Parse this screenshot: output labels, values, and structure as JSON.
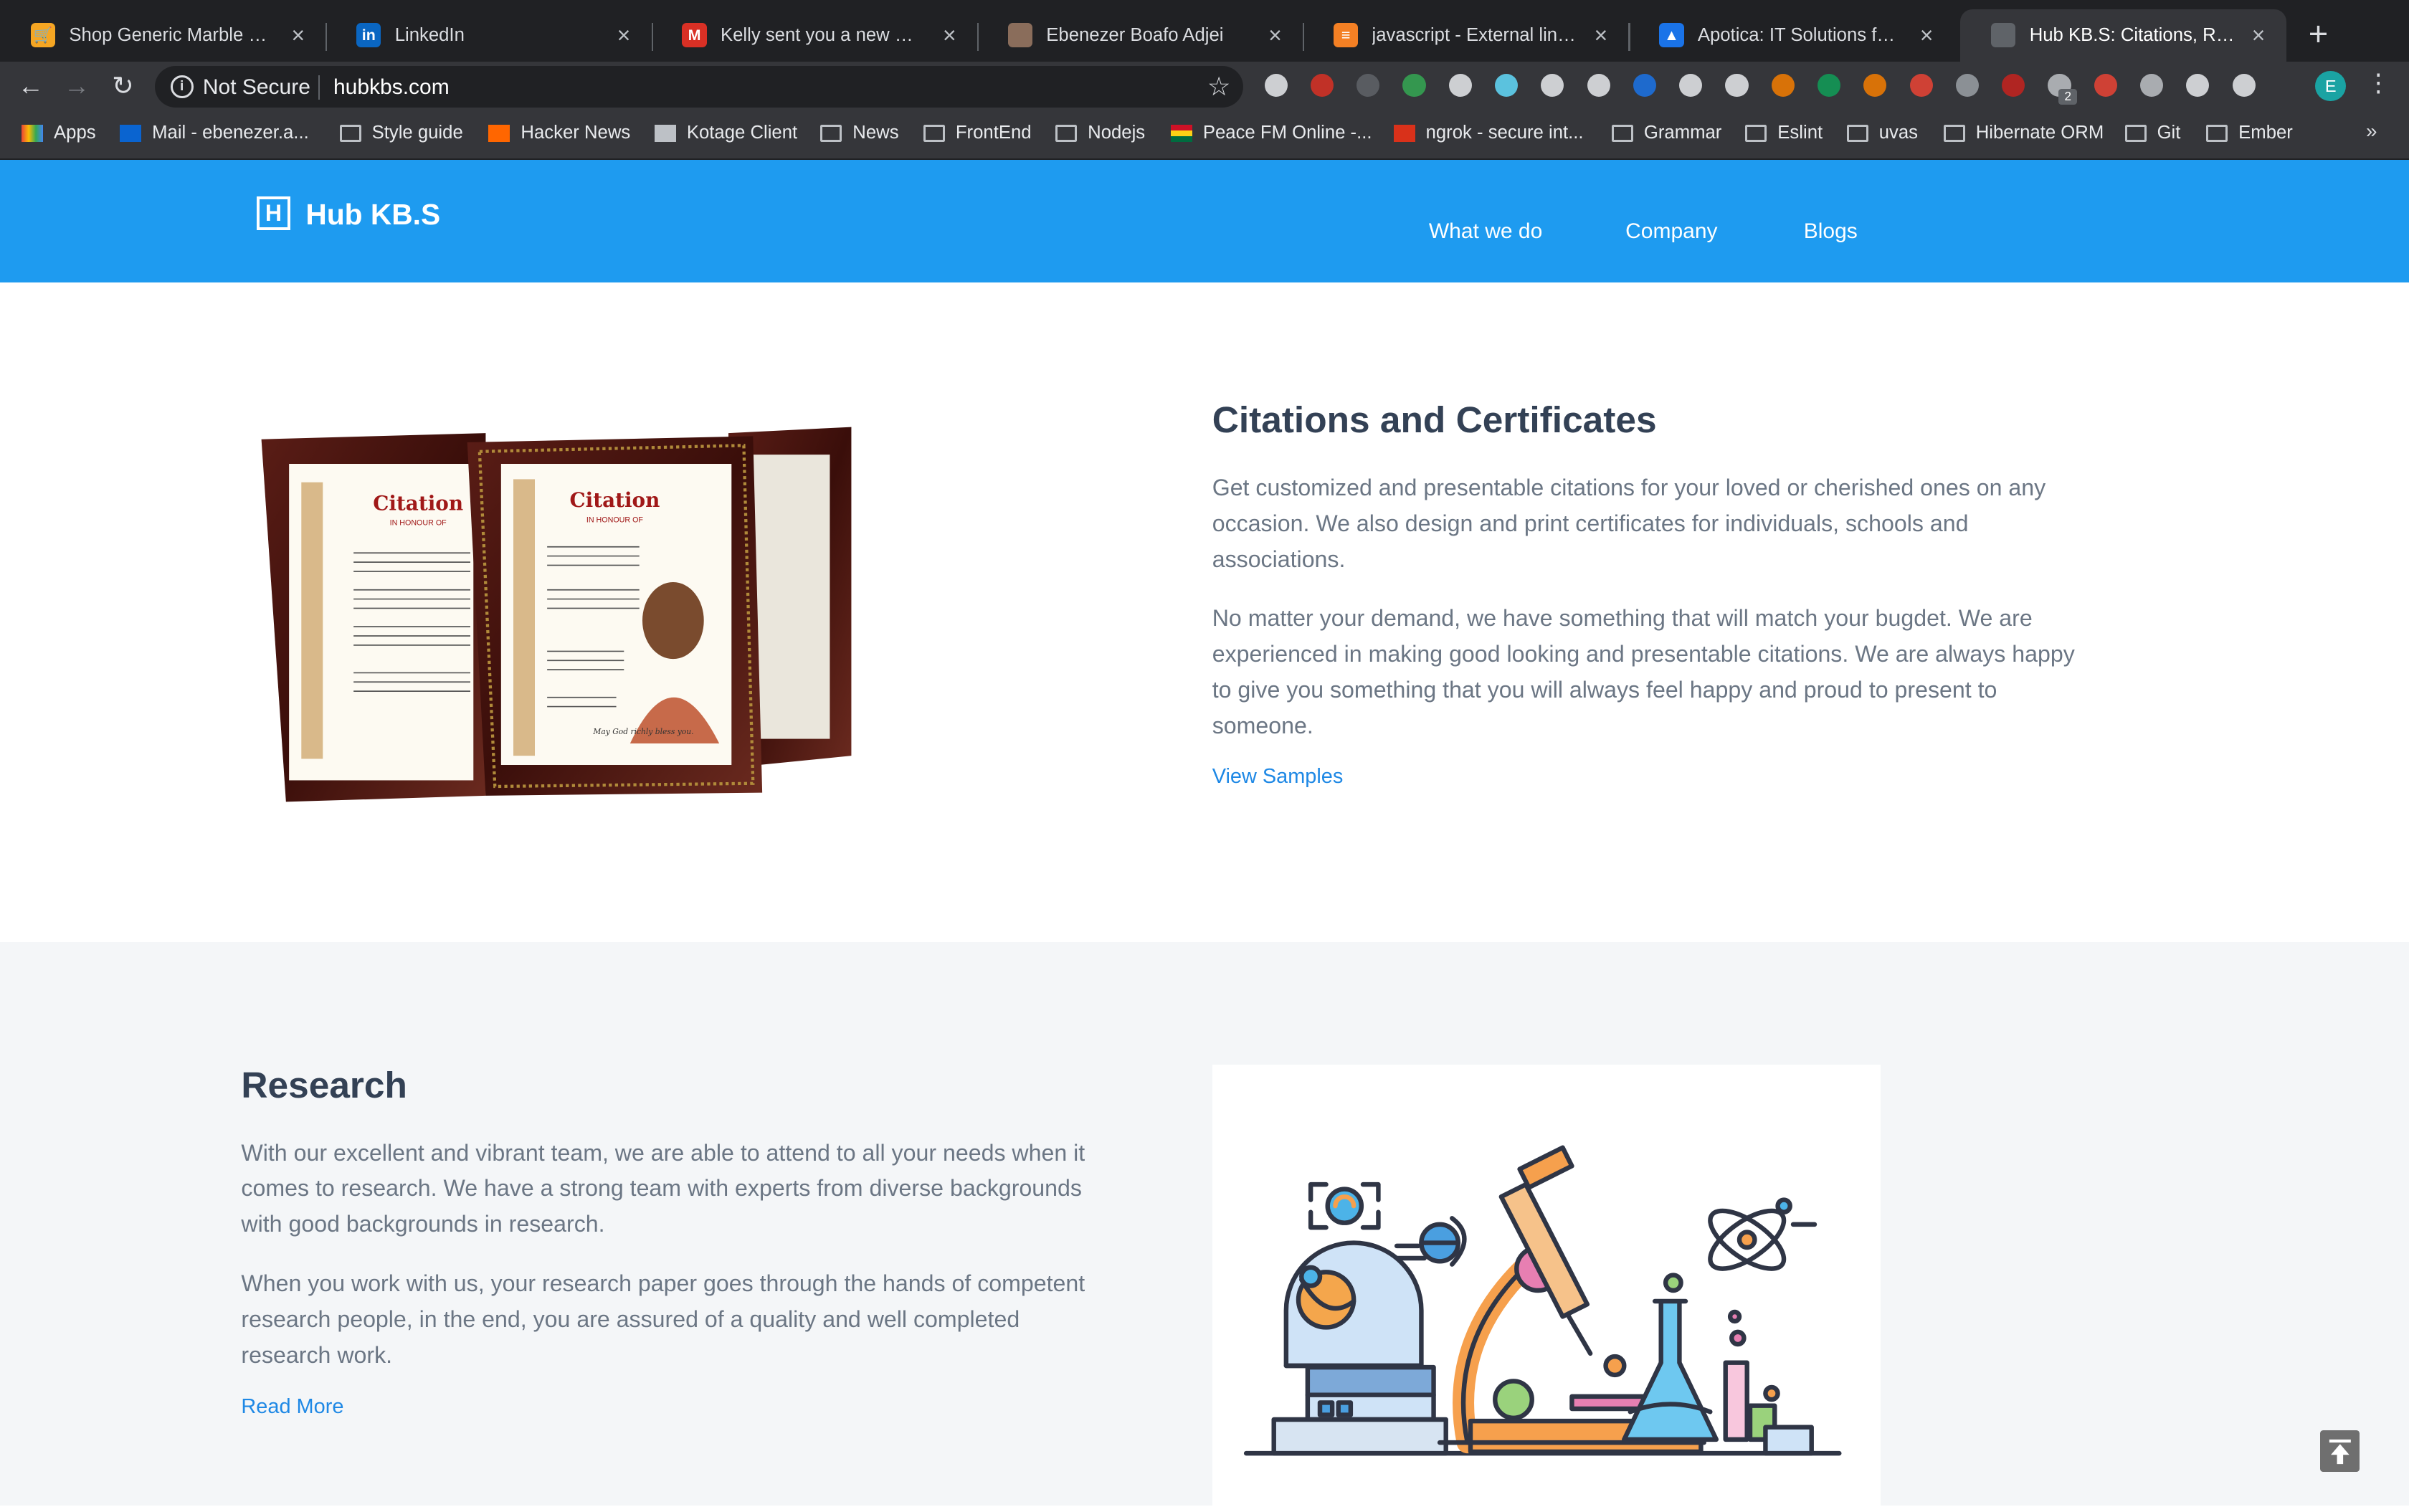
{
  "browser": {
    "tabs": [
      {
        "title": "Shop Generic Marble Matte Finish",
        "color": "#f5a623",
        "glyph": "🛒"
      },
      {
        "title": "LinkedIn",
        "color": "#0a66c2",
        "glyph": "in"
      },
      {
        "title": "Kelly sent you a new message",
        "color": "#d93025",
        "glyph": "M"
      },
      {
        "title": "Ebenezer Boafo Adjei",
        "color": "#8a6d5b",
        "glyph": ""
      },
      {
        "title": "javascript - External link is not working",
        "color": "#f48024",
        "glyph": "≡"
      },
      {
        "title": "Apotica: IT Solutions for Business",
        "color": "#1a73e8",
        "glyph": "▲"
      },
      {
        "title": "Hub KB.S: Citations, Research",
        "color": "#5f6368",
        "glyph": ""
      }
    ],
    "new_tab": "+",
    "back": "←",
    "forward": "→",
    "reload": "↻",
    "security_label": "Not Secure",
    "url": "hubkbs.com",
    "profile_initial": "E",
    "bookmarks": [
      {
        "label": "Apps",
        "type": "apps"
      },
      {
        "label": "Mail - ebenezer.a...",
        "type": "mail"
      },
      {
        "label": "Style guide",
        "type": "folder"
      },
      {
        "label": "Hacker News",
        "type": "hn"
      },
      {
        "label": "Kotage Client",
        "type": "page"
      },
      {
        "label": "News",
        "type": "folder"
      },
      {
        "label": "FrontEnd",
        "type": "folder"
      },
      {
        "label": "Nodejs",
        "type": "folder"
      },
      {
        "label": "Peace FM Online -...",
        "type": "flag"
      },
      {
        "label": "ngrok - secure int...",
        "type": "ngrok"
      },
      {
        "label": "Grammar",
        "type": "folder"
      },
      {
        "label": "Eslint",
        "type": "folder"
      },
      {
        "label": "uvas",
        "type": "folder"
      },
      {
        "label": "Hibernate ORM",
        "type": "folder"
      },
      {
        "label": "Git",
        "type": "folder"
      },
      {
        "label": "Ember",
        "type": "folder"
      }
    ],
    "bookmarks_more": "»",
    "extension_badge": "2"
  },
  "site": {
    "brand": "Hub KB.S",
    "logo_letter": "H",
    "nav": [
      "What we do",
      "Company",
      "Blogs"
    ],
    "citations": {
      "title": "Citations and Certificates",
      "paragraphs": [
        "Get customized and presentable citations for your loved or cherished ones on any occasion. We also design and print certificates for individuals, schools and associations.",
        "No matter your demand, we have something that will match your bugdet. We are experienced in making good looking and presentable citations. We are always happy to give you something that you will always feel happy and proud to present to someone."
      ],
      "link": "View Samples",
      "image": {
        "heading": "Citation",
        "subheading": "IN HONOUR OF",
        "signoff": "May God richly bless you."
      }
    },
    "research": {
      "title": "Research",
      "paragraphs": [
        "With our excellent and vibrant team, we are able to attend to all your needs when it comes to research. We have a strong team with experts from diverse backgrounds with good backgrounds in research.",
        "When you work with us, your research paper goes through the hands of competent research people, in the end, you are assured of a quality and well completed research work."
      ],
      "link": "Read More"
    }
  },
  "colors": {
    "header": "#1e9bf0",
    "heading": "#334155",
    "body_text": "#6b7684",
    "link": "#1e88e5",
    "section_bg": "#f4f6f8"
  }
}
